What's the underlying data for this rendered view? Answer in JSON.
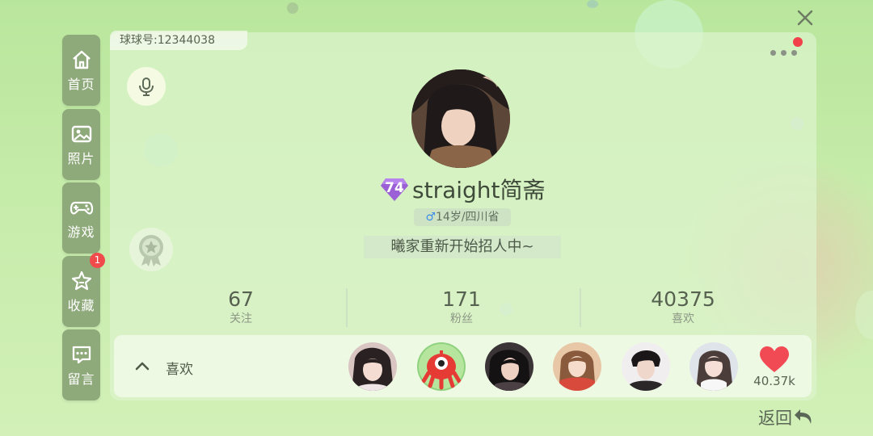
{
  "sidebar": {
    "items": [
      {
        "label": "首页",
        "icon": "home-icon"
      },
      {
        "label": "照片",
        "icon": "photo-icon"
      },
      {
        "label": "游戏",
        "icon": "gamepad-icon"
      },
      {
        "label": "收藏",
        "icon": "star-icon",
        "badge": "1"
      },
      {
        "label": "留言",
        "icon": "message-icon"
      }
    ]
  },
  "profile": {
    "ball_id": "球球号:12344038",
    "level": "74",
    "nickname": "straight简斋",
    "gender_symbol": "♂",
    "age_location": "14岁/四川省",
    "signature": "曦家重新开始招人中~"
  },
  "stats": [
    {
      "value": "67",
      "label": "关注"
    },
    {
      "value": "171",
      "label": "粉丝"
    },
    {
      "value": "40375",
      "label": "喜欢"
    }
  ],
  "likes_bar": {
    "label": "喜欢",
    "count": "40.37k"
  },
  "footer": {
    "back_label": "返回"
  },
  "colors": {
    "sidebar_tab": "#8ea97a",
    "badge": "#f04a4a",
    "heart": "#f24a55",
    "level_gem": "#9b5fd6",
    "male": "#3c8ee8"
  }
}
